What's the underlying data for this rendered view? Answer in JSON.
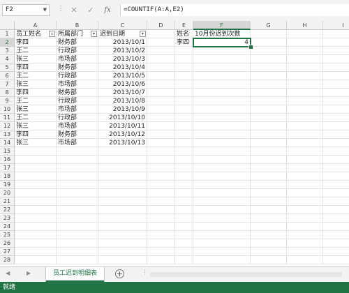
{
  "formula_bar": {
    "name_box": "F2",
    "cancel_icon": "✕",
    "enter_icon": "✓",
    "fx_icon": "fx",
    "formula": "=COUNTIF(A:A,E2)"
  },
  "columns": [
    "A",
    "B",
    "C",
    "D",
    "E",
    "F",
    "G",
    "H",
    "I"
  ],
  "selected_column": "F",
  "rows": [
    "1",
    "2",
    "3",
    "4",
    "5",
    "6",
    "7",
    "8",
    "9",
    "10",
    "11",
    "12",
    "13",
    "14",
    "15",
    "16",
    "17",
    "18",
    "19",
    "20",
    "21",
    "22",
    "23",
    "24",
    "25",
    "26",
    "27",
    "28"
  ],
  "selected_row": "2",
  "table": {
    "headers": [
      "员工姓名",
      "所属部门",
      "迟到日期"
    ],
    "records": [
      [
        "李四",
        "财务部",
        "2013/10/1"
      ],
      [
        "王二",
        "行政部",
        "2013/10/2"
      ],
      [
        "张三",
        "市场部",
        "2013/10/3"
      ],
      [
        "李四",
        "财务部",
        "2013/10/4"
      ],
      [
        "王二",
        "行政部",
        "2013/10/5"
      ],
      [
        "张三",
        "市场部",
        "2013/10/6"
      ],
      [
        "李四",
        "财务部",
        "2013/10/7"
      ],
      [
        "王二",
        "行政部",
        "2013/10/8"
      ],
      [
        "张三",
        "市场部",
        "2013/10/9"
      ],
      [
        "王二",
        "行政部",
        "2013/10/10"
      ],
      [
        "张三",
        "市场部",
        "2013/10/11"
      ],
      [
        "李四",
        "财务部",
        "2013/10/12"
      ],
      [
        "张三",
        "市场部",
        "2013/10/13"
      ]
    ]
  },
  "lookup": {
    "header_name": "姓名",
    "header_count": "10月份迟到次数",
    "name": "李四",
    "count": "4"
  },
  "sheet_tabs": {
    "active": "员工迟到明细表",
    "add_icon": "+",
    "prev_icon": "◀",
    "next_icon": "▶"
  },
  "status_bar": {
    "text": "就绪"
  },
  "colors": {
    "accent": "#217346"
  }
}
